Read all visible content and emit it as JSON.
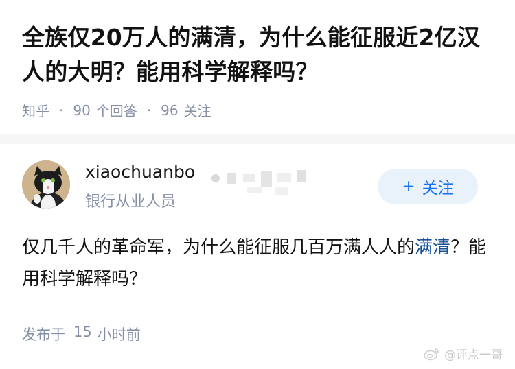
{
  "question": {
    "title": "全族仅20万人的满清，为什么能征服近2亿汉人的大明？能用科学解释吗？",
    "source": "知乎",
    "answers_count": "90",
    "answers_label": "个回答",
    "followers_count": "96",
    "followers_label": "关注"
  },
  "answer": {
    "author_name": "xiaochuanbo",
    "author_bio": "银行从业人员",
    "follow_label": "关注",
    "follow_icon": "plus-icon",
    "text_part1": "仅几千人的革命军，为什么能征服几百万满人人的",
    "text_link": "满清",
    "text_part2": "？能用科学解释吗？",
    "time_prefix": "发布于",
    "time_value": "15",
    "time_suffix": "小时前"
  },
  "watermark": {
    "icon": "weibo-icon",
    "text": "@评点一哥"
  },
  "colors": {
    "meta_gray": "#8590a6",
    "accent_blue": "#1772f6",
    "follow_bg": "#e9f2fb",
    "link_blue": "#175199",
    "divider": "#f6f6f6"
  }
}
